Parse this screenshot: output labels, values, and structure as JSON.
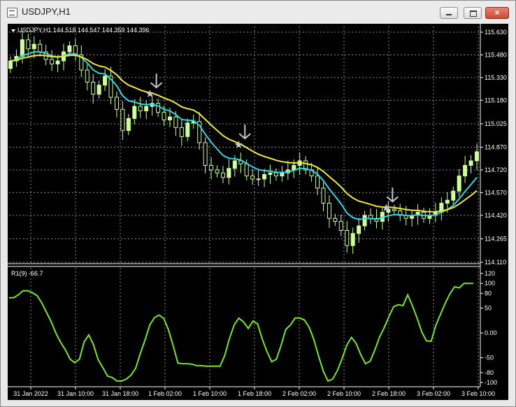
{
  "window": {
    "title": "USDJPY,H1",
    "close_glyph": "×"
  },
  "price_panel": {
    "label": "USDJPY,H1  144.518 144.547 144.359 144.396",
    "yticks": [
      "115.630",
      "115.480",
      "115.330",
      "115.180",
      "115.025",
      "114.870",
      "114.720",
      "114.570",
      "114.420",
      "114.265",
      "114.110"
    ],
    "ylim": [
      114.11,
      115.63
    ]
  },
  "rsi_panel": {
    "label": "R1(9) -66.7",
    "yticks": [
      "120",
      "100",
      "80",
      "50",
      "0.00",
      "-50",
      "-80",
      "-100"
    ],
    "ylim": [
      -100,
      120
    ]
  },
  "xticks": [
    "31 Jan 2022",
    "31 Jan 10:00",
    "31 Jan 18:00",
    "1 Feb 02:00",
    "1 Feb 10:00",
    "1 Feb 18:00",
    "2 Feb 02:00",
    "2 Feb 10:00",
    "2 Feb 18:00",
    "3 Feb 02:00",
    "3 Feb 10:00"
  ],
  "colors": {
    "background": "#000000",
    "grid": "#7f8c95",
    "bull_candle": "#ccff99",
    "bear_candle": "#000000",
    "candle_outline": "#ccff99",
    "fast_ma": "#33d6e8",
    "slow_ma": "#f2e93a",
    "rsi_line": "#7be81c",
    "marker": "#c8c8c8"
  },
  "markers": {
    "arrow_icon": "down-arrow-icon",
    "star_icon": "star-icon",
    "bars": [
      24,
      39,
      64
    ]
  },
  "chart_data": {
    "type": "candlestick",
    "ohlc_close": [
      115.44,
      115.47,
      115.58,
      115.52,
      115.55,
      115.5,
      115.45,
      115.42,
      115.44,
      115.5,
      115.54,
      115.48,
      115.38,
      115.3,
      115.22,
      115.28,
      115.34,
      115.2,
      115.12,
      114.98,
      115.06,
      115.14,
      115.11,
      115.14,
      115.16,
      115.1,
      115.05,
      115.07,
      115.0,
      114.94,
      115.03,
      115.04,
      114.9,
      114.75,
      114.72,
      114.7,
      114.67,
      114.73,
      114.78,
      114.76,
      114.68,
      114.66,
      114.66,
      114.69,
      114.7,
      114.68,
      114.7,
      114.72,
      114.75,
      114.78,
      114.72,
      114.68,
      114.6,
      114.5,
      114.4,
      114.38,
      114.32,
      114.22,
      114.3,
      114.35,
      114.42,
      114.4,
      114.38,
      114.44,
      114.46,
      114.45,
      114.42,
      114.4,
      114.42,
      114.44,
      114.4,
      114.42,
      114.44,
      114.5,
      114.52,
      114.58,
      114.68,
      114.75,
      114.78,
      114.84
    ],
    "fast_ma_name": "",
    "slow_ma_name": "",
    "rsi": [
      71,
      71,
      77,
      85,
      85,
      81,
      75,
      60,
      41,
      22,
      -1,
      -19,
      -34,
      -53,
      -60,
      -53,
      -18,
      -4,
      -24,
      -54,
      -70,
      -87,
      -90,
      -97,
      -97,
      -93,
      -85,
      -71,
      -41,
      -14,
      16,
      31,
      36,
      29,
      6,
      -26,
      -61,
      -62,
      -62,
      -63,
      -66,
      -66,
      -67,
      -67,
      -67,
      -67,
      -45,
      -11,
      16,
      30,
      22,
      9,
      24,
      18,
      -13,
      -38,
      -58,
      -53,
      -25,
      7,
      16,
      30,
      30,
      26,
      11,
      -14,
      -47,
      -77,
      -97,
      -93,
      -76,
      -52,
      -25,
      -9,
      -21,
      -44,
      -62,
      -57,
      -34,
      -8,
      11,
      33,
      53,
      57,
      55,
      77,
      55,
      30,
      2,
      -16,
      -17,
      15,
      38,
      60,
      79,
      93,
      91,
      100,
      100,
      100
    ]
  }
}
